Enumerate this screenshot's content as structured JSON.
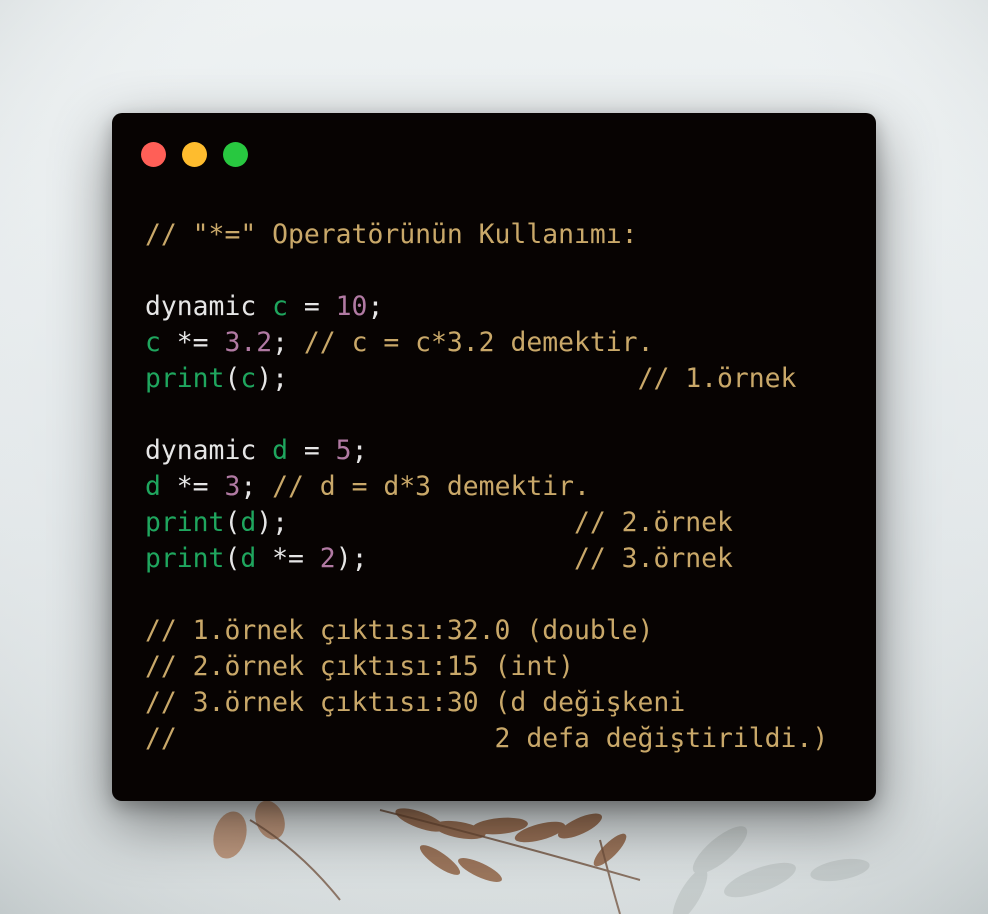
{
  "window": {
    "controls": [
      {
        "name": "close",
        "color": "#ff5f57"
      },
      {
        "name": "minimize",
        "color": "#febc2e"
      },
      {
        "name": "maximize",
        "color": "#28c840"
      }
    ]
  },
  "code": {
    "colors": {
      "comment": "#c9a869",
      "keyword": "#e6e6e6",
      "identifier": "#1fa65e",
      "number": "#b17aa3",
      "background": "#070302"
    },
    "lines": [
      [
        {
          "t": "// \"*=\" Operatörünün Kullanımı:",
          "c": "comment"
        }
      ],
      [],
      [
        {
          "t": "dynamic ",
          "c": "kw"
        },
        {
          "t": "c",
          "c": "var"
        },
        {
          "t": " = ",
          "c": "op"
        },
        {
          "t": "10",
          "c": "num"
        },
        {
          "t": ";",
          "c": "op"
        }
      ],
      [
        {
          "t": "c",
          "c": "var"
        },
        {
          "t": " *= ",
          "c": "op"
        },
        {
          "t": "3.2",
          "c": "num"
        },
        {
          "t": "; ",
          "c": "op"
        },
        {
          "t": "// c = c*3.2 demektir.",
          "c": "comment"
        }
      ],
      [
        {
          "t": "print",
          "c": "fn"
        },
        {
          "t": "(",
          "c": "op"
        },
        {
          "t": "c",
          "c": "var"
        },
        {
          "t": ");                      ",
          "c": "op"
        },
        {
          "t": "// 1.örnek",
          "c": "comment"
        }
      ],
      [],
      [
        {
          "t": "dynamic ",
          "c": "kw"
        },
        {
          "t": "d",
          "c": "var"
        },
        {
          "t": " = ",
          "c": "op"
        },
        {
          "t": "5",
          "c": "num"
        },
        {
          "t": ";",
          "c": "op"
        }
      ],
      [
        {
          "t": "d",
          "c": "var"
        },
        {
          "t": " *= ",
          "c": "op"
        },
        {
          "t": "3",
          "c": "num"
        },
        {
          "t": "; ",
          "c": "op"
        },
        {
          "t": "// d = d*3 demektir.",
          "c": "comment"
        }
      ],
      [
        {
          "t": "print",
          "c": "fn"
        },
        {
          "t": "(",
          "c": "op"
        },
        {
          "t": "d",
          "c": "var"
        },
        {
          "t": ");                  ",
          "c": "op"
        },
        {
          "t": "// 2.örnek",
          "c": "comment"
        }
      ],
      [
        {
          "t": "print",
          "c": "fn"
        },
        {
          "t": "(",
          "c": "op"
        },
        {
          "t": "d",
          "c": "var"
        },
        {
          "t": " *= ",
          "c": "op"
        },
        {
          "t": "2",
          "c": "num"
        },
        {
          "t": ");             ",
          "c": "op"
        },
        {
          "t": "// 3.örnek",
          "c": "comment"
        }
      ],
      [],
      [
        {
          "t": "// 1.örnek çıktısı:32.0 (double)",
          "c": "comment"
        }
      ],
      [
        {
          "t": "// 2.örnek çıktısı:15 (int)",
          "c": "comment"
        }
      ],
      [
        {
          "t": "// 3.örnek çıktısı:30 (d değişkeni",
          "c": "comment"
        }
      ],
      [
        {
          "t": "//                    2 defa değiştirildi.)",
          "c": "comment"
        }
      ]
    ]
  }
}
